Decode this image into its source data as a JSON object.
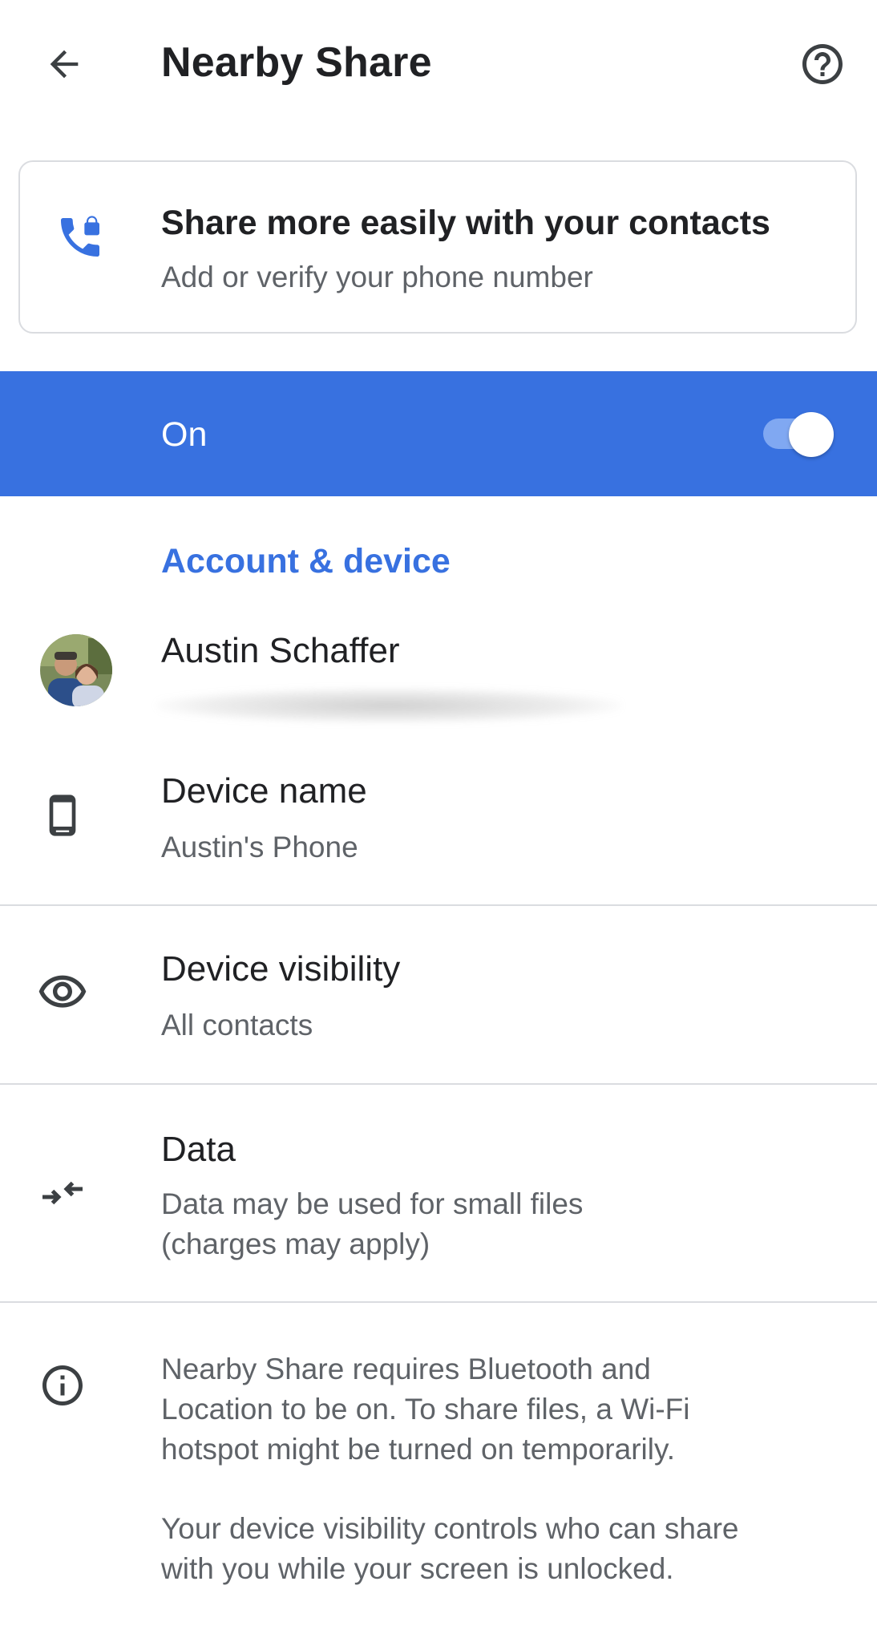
{
  "app_bar": {
    "title": "Nearby Share",
    "back_icon": "arrow-back-icon",
    "help_icon": "help-circle-icon"
  },
  "promo_card": {
    "title": "Share more easily with your contacts",
    "subtitle": "Add or verify your phone number",
    "icon": "phone-lock-icon"
  },
  "master_toggle": {
    "label": "On",
    "state": true
  },
  "section": {
    "header": "Account & device"
  },
  "account": {
    "name": "Austin Schaffer",
    "email": ""
  },
  "settings": [
    {
      "title": "Device name",
      "subtitle": "Austin's Phone",
      "icon": "smartphone-icon"
    },
    {
      "title": "Device visibility",
      "subtitle": "All contacts",
      "icon": "eye-icon"
    },
    {
      "title": "Data",
      "subtitle_line1": "Data may be used for small files",
      "subtitle_line2": "(charges may apply)",
      "icon": "data-arrows-icon"
    }
  ],
  "info": {
    "icon": "info-icon",
    "paragraph1_line1": "Nearby Share requires Bluetooth and",
    "paragraph1_line2": "Location to be on. To share files, a Wi-Fi",
    "paragraph1_line3": "hotspot might be turned on temporarily.",
    "paragraph2_line1": "Your device visibility controls who can share",
    "paragraph2_line2": "with you while your screen is unlocked."
  },
  "colors": {
    "accent": "#3871e0",
    "text_primary": "#202124",
    "text_secondary": "#5f6368",
    "divider": "#dadce0"
  }
}
